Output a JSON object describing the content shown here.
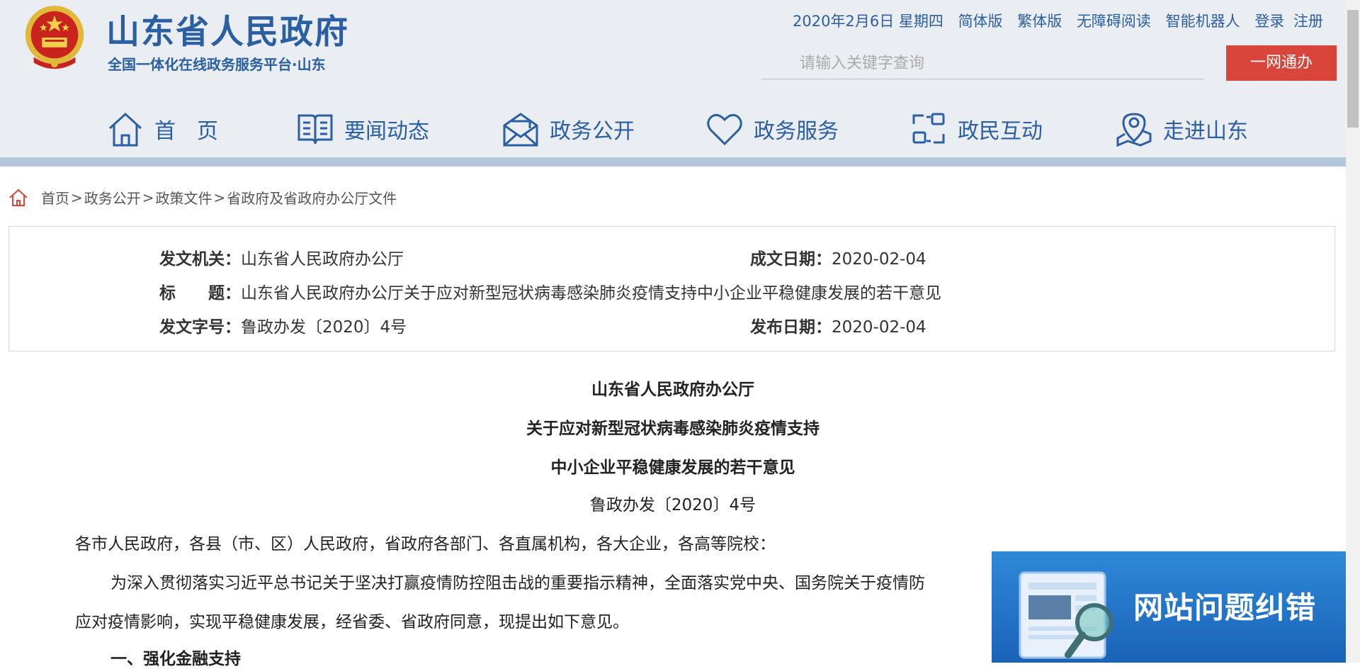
{
  "header": {
    "site_title": "山东省人民政府",
    "site_subtitle": "全国一体化在线政务服务平台·山东",
    "top_links": [
      "2020年2月6日 星期四",
      "简体版",
      "繁体版",
      "无障碍阅读",
      "智能机器人",
      "登录",
      "注册"
    ],
    "search_placeholder": "请输入关键字查询",
    "onenet_label": "一网通办"
  },
  "nav": {
    "items": [
      {
        "label": "首　页",
        "icon": "home-icon"
      },
      {
        "label": "要闻动态",
        "icon": "book-icon"
      },
      {
        "label": "政务公开",
        "icon": "mail-icon"
      },
      {
        "label": "政务服务",
        "icon": "heart-icon"
      },
      {
        "label": "政民互动",
        "icon": "exchange-icon"
      },
      {
        "label": "走进山东",
        "icon": "map-pin-icon"
      }
    ]
  },
  "breadcrumb": {
    "items": [
      "首页",
      "政务公开",
      "政策文件",
      "省政府及省政府办公厅文件"
    ],
    "sep": ">"
  },
  "meta": {
    "issuer_label": "发文机关：",
    "issuer": "山东省人民政府办公厅",
    "date_label": "成文日期：",
    "date": "2020-02-04",
    "title_label": "标　　题：",
    "title": "山东省人民政府办公厅关于应对新型冠状病毒感染肺炎疫情支持中小企业平稳健康发展的若干意见",
    "number_label": "发文字号：",
    "number": "鲁政办发〔2020〕4号",
    "publish_label": "发布日期：",
    "publish": "2020-02-04"
  },
  "document": {
    "title_lines": [
      "山东省人民政府办公厅",
      "关于应对新型冠状病毒感染肺炎疫情支持",
      "中小企业平稳健康发展的若干意见"
    ],
    "number": "鲁政办发〔2020〕4号",
    "salutation": "各市人民政府，各县（市、区）人民政府，省政府各部门、各直属机构，各大企业，各高等院校：",
    "para1_line1": "为深入贯彻落实习近平总书记关于坚决打赢疫情防控阻击战的重要指示精神，全面落实党中央、国务院关于疫情防",
    "para1_line2": "应对疫情影响，实现平稳健康发展，经省委、省政府同意，现提出如下意见。",
    "section1": "一、强化金融支持"
  },
  "float_widget": {
    "label": "网站问题纠错"
  },
  "colors": {
    "brand_blue": "#2b5fa3",
    "header_bg": "#eaeef3",
    "button_red": "#d9453b"
  }
}
